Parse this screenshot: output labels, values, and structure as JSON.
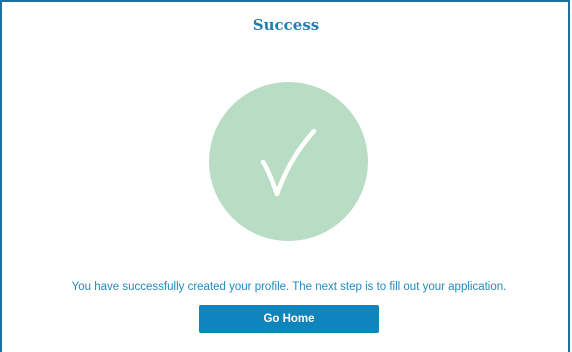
{
  "dialog": {
    "title": "Success",
    "icon": "checkmark-icon",
    "message": "You have successfully created your profile. The next step is to fill out your application.",
    "primary_button_label": "Go Home"
  },
  "colors": {
    "frame_border": "#1f6f9f",
    "title": "#1f7fb0",
    "circle": "#b9dcc4",
    "check": "#ffffff",
    "message": "#2389bd",
    "button_bg": "#0f84bd",
    "button_text": "#ffffff"
  }
}
